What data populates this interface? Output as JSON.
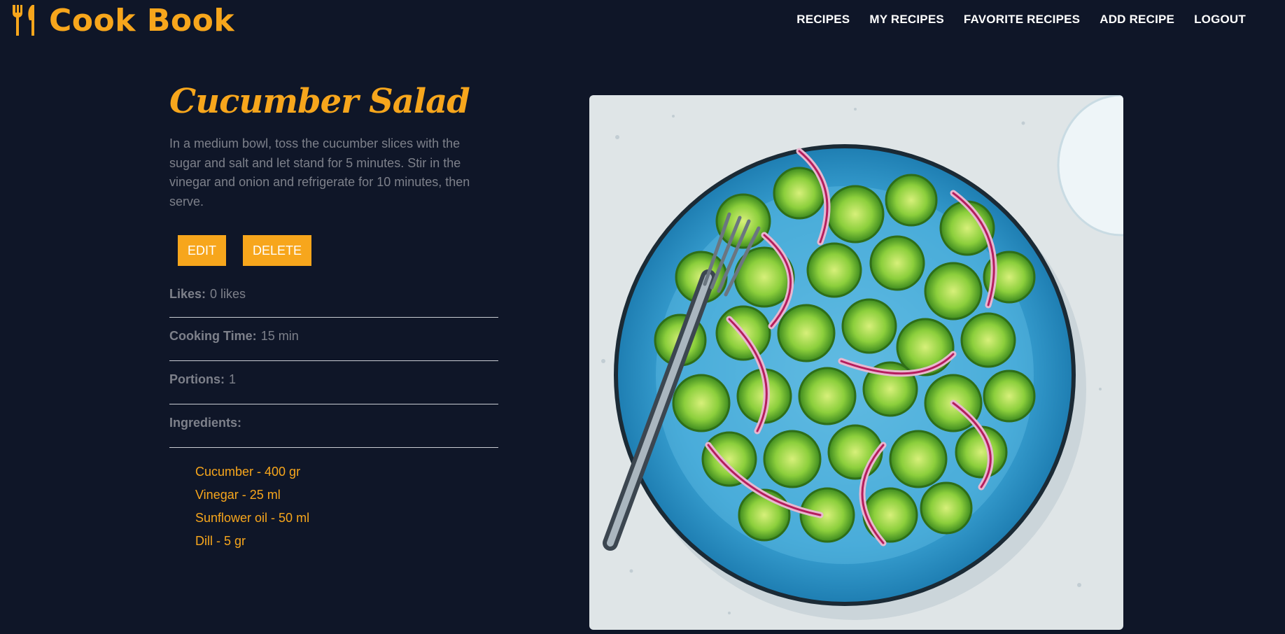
{
  "header": {
    "brand": "Cook Book",
    "logo_icon": "fork-knife-icon",
    "nav": [
      "RECIPES",
      "MY RECIPES",
      "FAVORITE RECIPES",
      "ADD RECIPE",
      "LOGOUT"
    ]
  },
  "recipe": {
    "title": "Cucumber Salad",
    "description": "In a medium bowl, toss the cucumber slices with the sugar and salt and let stand for 5 minutes. Stir in the vinegar and onion and refrigerate for 10 minutes, then serve.",
    "buttons": {
      "edit": "EDIT",
      "delete": "DELETE"
    },
    "likes": {
      "label": "Likes:",
      "value": "0 likes"
    },
    "cooking_time": {
      "label": "Cooking Time:",
      "value": "15 min"
    },
    "portions": {
      "label": "Portions:",
      "value": "1"
    },
    "ingredients_label": "Ingredients:",
    "ingredients": [
      "Cucumber - 400 gr",
      "Vinegar - 25 ml",
      "Sunflower oil - 50 ml",
      "Dill - 5 gr"
    ]
  },
  "colors": {
    "background": "#0f1628",
    "accent": "#f7a61c",
    "muted_text": "#7d808a"
  }
}
